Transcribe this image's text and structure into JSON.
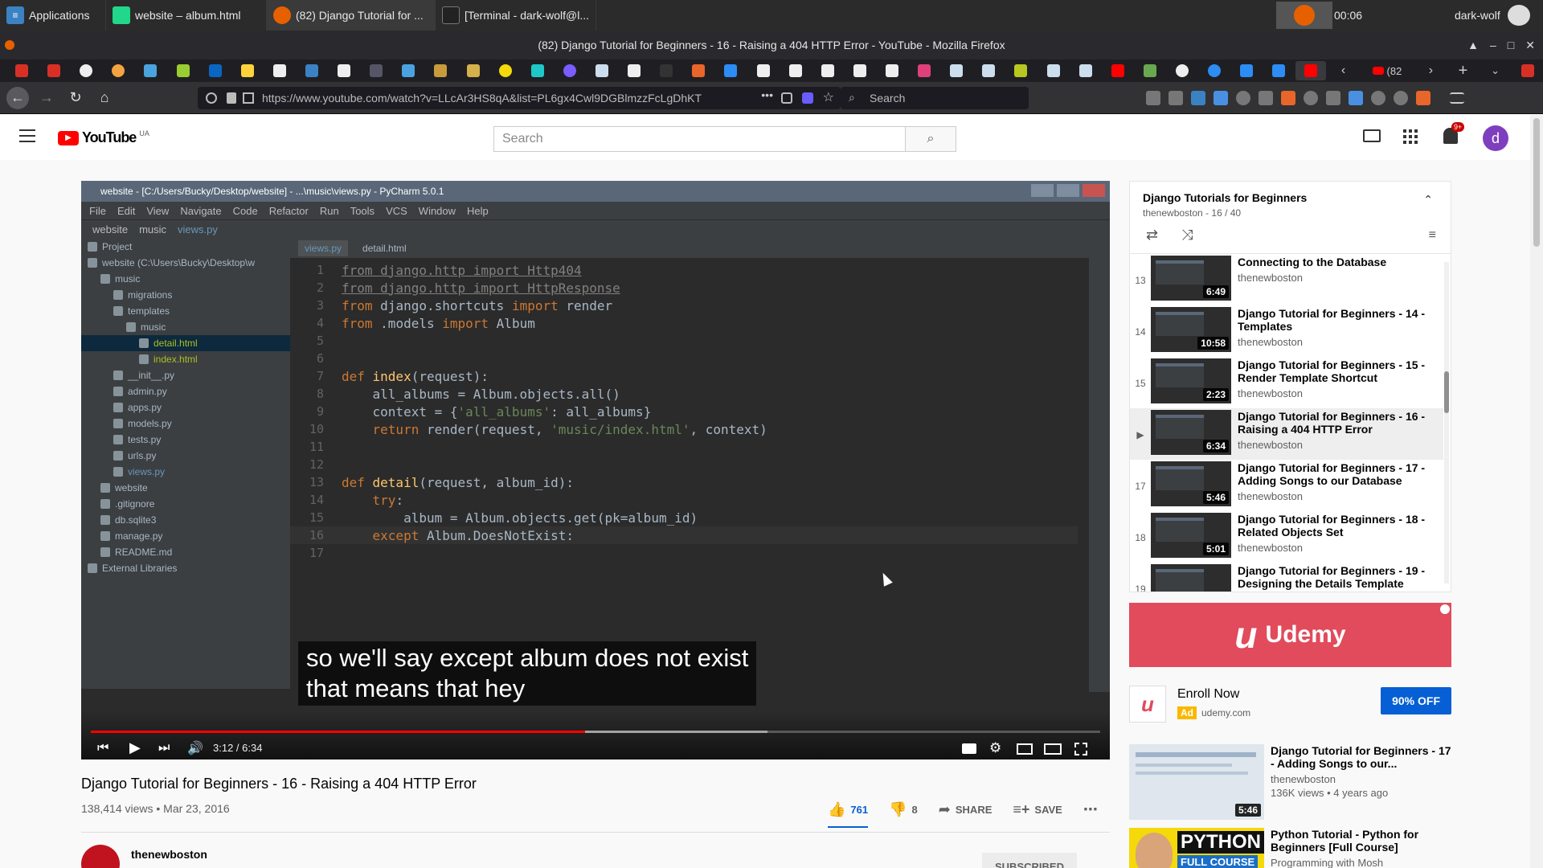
{
  "taskbar": {
    "apps": [
      {
        "label": "Applications"
      },
      {
        "label": "website – album.html"
      },
      {
        "label": "(82) Django Tutorial for ..."
      },
      {
        "label": "[Terminal - dark-wolf@l..."
      }
    ],
    "clock": "00:06",
    "user": "dark-wolf"
  },
  "window_title": "(82) Django Tutorial for Beginners - 16 - Raising a 404 HTTP Error - YouTube - Mozilla Firefox",
  "browser": {
    "url": "https://www.youtube.com/watch?v=LLcAr3HS8qA&list=PL6gx4Cwl9DGBlmzzFcLgDhKT",
    "search_placeholder": "Search",
    "tab_badge": "(82"
  },
  "youtube": {
    "logo_text": "YouTube",
    "logo_region": "UA",
    "search_placeholder": "Search",
    "notif_count": "9+",
    "avatar_letter": "d"
  },
  "video": {
    "ide_title": "website - [C:/Users/Bucky/Desktop/website] - ...\\music\\views.py - PyCharm 5.0.1",
    "ide_menu": [
      "File",
      "Edit",
      "View",
      "Navigate",
      "Code",
      "Refactor",
      "Run",
      "Tools",
      "VCS",
      "Window",
      "Help"
    ],
    "ide_breadcrumb": [
      "website",
      "music",
      "views.py"
    ],
    "ide_tabs": [
      "views.py",
      "detail.html"
    ],
    "project_tree": [
      {
        "depth": 0,
        "label": "Project"
      },
      {
        "depth": 0,
        "label": "website (C:\\Users\\Bucky\\Desktop\\w"
      },
      {
        "depth": 1,
        "label": "music"
      },
      {
        "depth": 2,
        "label": "migrations"
      },
      {
        "depth": 2,
        "label": "templates"
      },
      {
        "depth": 3,
        "label": "music"
      },
      {
        "depth": 4,
        "label": "detail.html"
      },
      {
        "depth": 4,
        "label": "index.html"
      },
      {
        "depth": 2,
        "label": "__init__.py"
      },
      {
        "depth": 2,
        "label": "admin.py"
      },
      {
        "depth": 2,
        "label": "apps.py"
      },
      {
        "depth": 2,
        "label": "models.py"
      },
      {
        "depth": 2,
        "label": "tests.py"
      },
      {
        "depth": 2,
        "label": "urls.py"
      },
      {
        "depth": 2,
        "label": "views.py"
      },
      {
        "depth": 1,
        "label": "website"
      },
      {
        "depth": 1,
        "label": ".gitignore"
      },
      {
        "depth": 1,
        "label": "db.sqlite3"
      },
      {
        "depth": 1,
        "label": "manage.py"
      },
      {
        "depth": 1,
        "label": "README.md"
      },
      {
        "depth": 0,
        "label": "External Libraries"
      }
    ],
    "code_lines": [
      {
        "n": "1",
        "parts": [
          [
            "dim",
            "from django.http import Http404"
          ]
        ]
      },
      {
        "n": "2",
        "parts": [
          [
            "dim",
            "from django.http import HttpResponse"
          ]
        ]
      },
      {
        "n": "3",
        "parts": [
          [
            "kw",
            "from "
          ],
          [
            "t",
            "django.shortcuts "
          ],
          [
            "kw",
            "import "
          ],
          [
            "t",
            "render"
          ]
        ]
      },
      {
        "n": "4",
        "parts": [
          [
            "kw",
            "from "
          ],
          [
            "t",
            ".models "
          ],
          [
            "kw",
            "import "
          ],
          [
            "t",
            "Album"
          ]
        ]
      },
      {
        "n": "5",
        "parts": []
      },
      {
        "n": "6",
        "parts": []
      },
      {
        "n": "7",
        "parts": [
          [
            "kw",
            "def "
          ],
          [
            "fn",
            "index"
          ],
          [
            "t",
            "(request):"
          ]
        ]
      },
      {
        "n": "8",
        "parts": [
          [
            "t",
            "    all_albums = Album.objects.all()"
          ]
        ]
      },
      {
        "n": "9",
        "parts": [
          [
            "t",
            "    context = {"
          ],
          [
            "str",
            "'all_albums'"
          ],
          [
            "t",
            ": all_albums}"
          ]
        ]
      },
      {
        "n": "10",
        "parts": [
          [
            "kw",
            "    return "
          ],
          [
            "t",
            "render(request, "
          ],
          [
            "str",
            "'music/index.html'"
          ],
          [
            "t",
            ", context)"
          ]
        ]
      },
      {
        "n": "11",
        "parts": []
      },
      {
        "n": "12",
        "parts": []
      },
      {
        "n": "13",
        "parts": [
          [
            "kw",
            "def "
          ],
          [
            "fn",
            "detail"
          ],
          [
            "t",
            "(request, album_id):"
          ]
        ]
      },
      {
        "n": "14",
        "parts": [
          [
            "kw",
            "    try"
          ],
          [
            "t",
            ":"
          ]
        ]
      },
      {
        "n": "15",
        "parts": [
          [
            "t",
            "        album = Album.objects.get(pk=album_id)"
          ]
        ]
      },
      {
        "n": "16",
        "parts": [
          [
            "kw",
            "    except "
          ],
          [
            "t",
            "Album.DoesNotExist:"
          ]
        ]
      },
      {
        "n": "17",
        "parts": []
      }
    ],
    "caption_line1": "so we'll say except album does not exist",
    "caption_line2": "that means that hey",
    "time": "3:12 / 6:34",
    "played": 0.49,
    "buffered": 0.67,
    "title": "Django Tutorial for Beginners - 16 - Raising a 404 HTTP Error",
    "views_date": "138,414 views • Mar 23, 2016",
    "likes": "761",
    "dislikes": "8",
    "share": "SHARE",
    "save": "SAVE",
    "channel": "thenewboston",
    "subscribed": "SUBSCRIBED"
  },
  "playlist": {
    "title": "Django Tutorials for Beginners",
    "subtitle": "thenewboston - 16 / 40",
    "items": [
      {
        "idx": "13",
        "title": "Connecting to the Database",
        "channel": "thenewboston",
        "duration": "6:49",
        "selected": false
      },
      {
        "idx": "14",
        "title": "Django Tutorial for Beginners - 14 - Templates",
        "channel": "thenewboston",
        "duration": "10:58",
        "selected": false
      },
      {
        "idx": "15",
        "title": "Django Tutorial for Beginners - 15 - Render Template Shortcut",
        "channel": "thenewboston",
        "duration": "2:23",
        "selected": false
      },
      {
        "idx": "▶",
        "title": "Django Tutorial for Beginners - 16 - Raising a 404 HTTP Error",
        "channel": "thenewboston",
        "duration": "6:34",
        "selected": true
      },
      {
        "idx": "17",
        "title": "Django Tutorial for Beginners - 17 - Adding Songs to our Database",
        "channel": "thenewboston",
        "duration": "5:46",
        "selected": false
      },
      {
        "idx": "18",
        "title": "Django Tutorial for Beginners - 18 - Related Objects Set",
        "channel": "thenewboston",
        "duration": "5:01",
        "selected": false
      },
      {
        "idx": "19",
        "title": "Django Tutorial for Beginners - 19 - Designing the Details Template",
        "channel": "thenewboston",
        "duration": "",
        "selected": false
      }
    ]
  },
  "ad": {
    "brand": "Udemy",
    "enroll": "Enroll Now",
    "ad_label": "Ad",
    "domain": "udemy.com",
    "cta": "90% OFF"
  },
  "recommended": [
    {
      "title": "Django Tutorial for Beginners - 17 - Adding Songs to our...",
      "channel": "thenewboston",
      "meta": "136K views • 4 years ago",
      "duration": "5:46"
    },
    {
      "title": "Python Tutorial - Python for Beginners [Full Course]",
      "channel": "Programming with Mosh",
      "meta": "",
      "duration": ""
    }
  ],
  "colors": {
    "yt_red": "#ff0000",
    "udemy": "#e14b5c",
    "link_blue": "#065fd4"
  }
}
